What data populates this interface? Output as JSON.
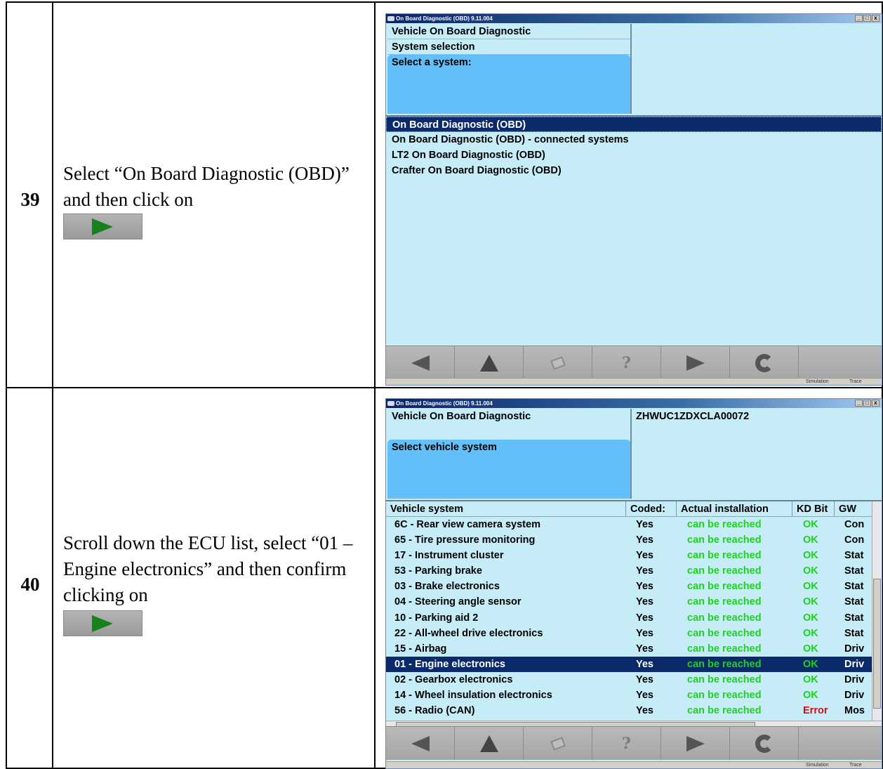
{
  "steps": [
    {
      "number": "39",
      "text": "Select “On Board Diagnostic (OBD)” and then click on",
      "window": {
        "title": "On Board Diagnostic (OBD) 9.11.004",
        "header_lines": [
          "Vehicle On Board Diagnostic",
          "System selection"
        ],
        "header_selected": "Select a system:",
        "header_right": "",
        "systems": [
          {
            "label": "On Board Diagnostic (OBD)",
            "selected": true
          },
          {
            "label": "On Board Diagnostic (OBD) - connected systems",
            "selected": false
          },
          {
            "label": "LT2 On Board Diagnostic (OBD)",
            "selected": false
          },
          {
            "label": "Crafter On Board Diagnostic (OBD)",
            "selected": false
          }
        ]
      }
    },
    {
      "number": "40",
      "text": "Scroll down the ECU list, select “01 – Engine electronics” and then confirm clicking on",
      "window": {
        "title": "On Board Diagnostic (OBD) 9.11.004",
        "header_lines": [
          "Vehicle On Board Diagnostic",
          ""
        ],
        "header_selected": "Select vehicle system",
        "header_right": "ZHWUC1ZDXCLA00072",
        "columns": [
          "Vehicle system",
          "Coded:",
          "Actual installation",
          "KD Bit",
          "GW"
        ],
        "rows": [
          [
            "6C - Rear view camera system",
            "Yes",
            "can be reached",
            "OK",
            "Con"
          ],
          [
            "65 - Tire pressure monitoring",
            "Yes",
            "can be reached",
            "OK",
            "Con"
          ],
          [
            "17 - Instrument cluster",
            "Yes",
            "can be reached",
            "OK",
            "Stat"
          ],
          [
            "53 - Parking brake",
            "Yes",
            "can be reached",
            "OK",
            "Stat"
          ],
          [
            "03 - Brake electronics",
            "Yes",
            "can be reached",
            "OK",
            "Stat"
          ],
          [
            "04 - Steering angle sensor",
            "Yes",
            "can be reached",
            "OK",
            "Stat"
          ],
          [
            "10 - Parking aid 2",
            "Yes",
            "can be reached",
            "OK",
            "Stat"
          ],
          [
            "22 - All-wheel drive electronics",
            "Yes",
            "can be reached",
            "OK",
            "Stat"
          ],
          [
            "15 - Airbag",
            "Yes",
            "can be reached",
            "OK",
            "Driv"
          ],
          [
            "01 - Engine electronics",
            "Yes",
            "can be reached",
            "OK",
            "Driv"
          ],
          [
            "02 - Gearbox electronics",
            "Yes",
            "can be reached",
            "OK",
            "Driv"
          ],
          [
            "14 - Wheel insulation electronics",
            "Yes",
            "can be reached",
            "OK",
            "Driv"
          ],
          [
            "56 - Radio (CAN)",
            "Yes",
            "can be reached",
            "Error",
            "Mos"
          ]
        ],
        "selected_row": 9
      }
    }
  ],
  "toolbar": [
    "back-icon",
    "up-icon",
    "print-icon",
    "help-icon",
    "next-icon",
    "refresh-icon"
  ],
  "help_glyph": "?",
  "status": {
    "simulation": "Simulation",
    "trace": "Trace"
  }
}
